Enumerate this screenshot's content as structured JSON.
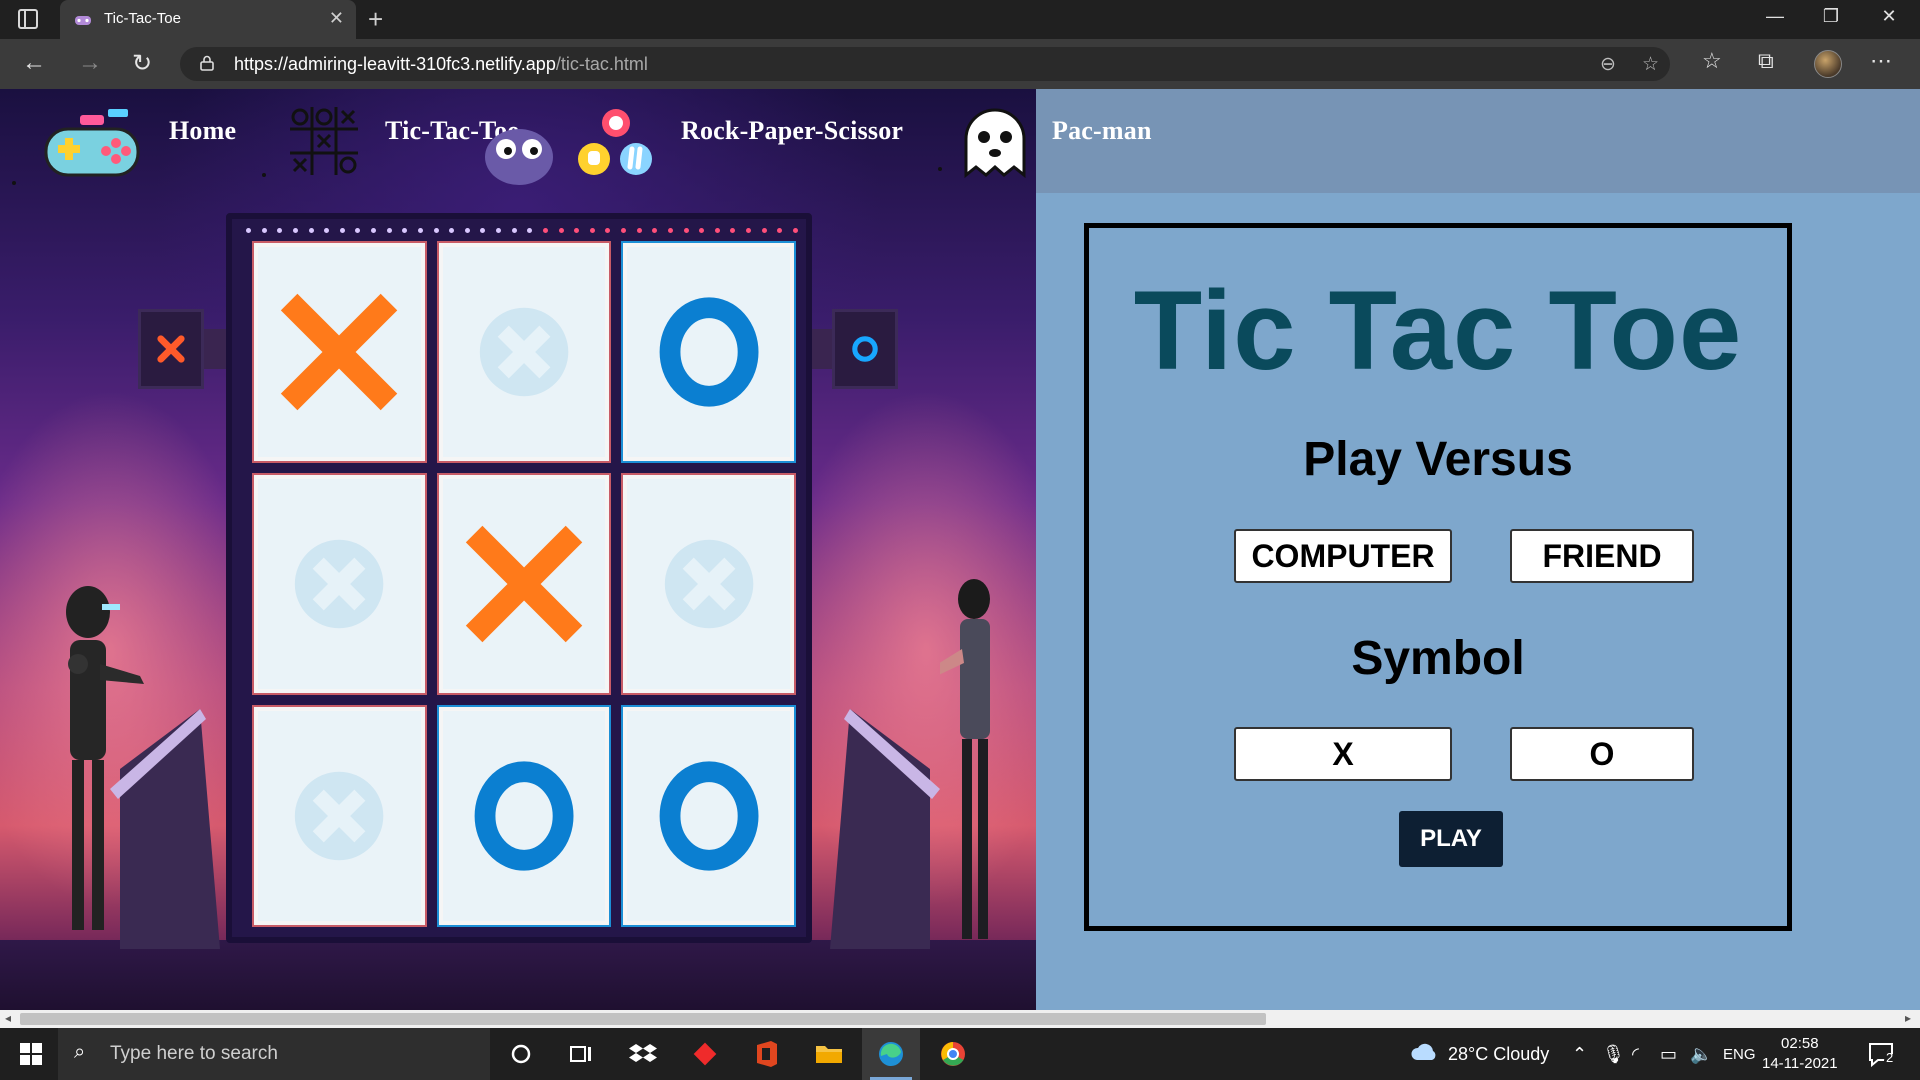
{
  "browser": {
    "tab_title": "Tic-Tac-Toe",
    "url_host": "https://admiring-leavitt-310fc3.netlify.app",
    "url_path": "/tic-tac.html"
  },
  "nav": {
    "home": "Home",
    "tictactoe": "Tic-Tac-Toe",
    "rps": "Rock-Paper-Scissor",
    "pacman": "Pac-man"
  },
  "panel": {
    "title": "Tic Tac Toe",
    "versus_heading": "Play Versus",
    "versus_options": [
      "COMPUTER",
      "FRIEND"
    ],
    "symbol_heading": "Symbol",
    "symbol_options": [
      "X",
      "O"
    ],
    "play_label": "PLAY"
  },
  "board": [
    "X",
    "",
    "O",
    "",
    "X",
    "",
    "",
    "O",
    "O"
  ],
  "taskbar": {
    "search_placeholder": "Type here to search",
    "weather": "28°C  Cloudy",
    "language": "ENG",
    "time": "02:58",
    "date": "14-11-2021",
    "notifications": "2"
  },
  "colors": {
    "panel_bg": "#7ea7cc",
    "title_color": "#0a4a5c",
    "play_bg": "#0d1f33",
    "x_color": "#ff7a1a",
    "o_color": "#0b7fd1"
  }
}
